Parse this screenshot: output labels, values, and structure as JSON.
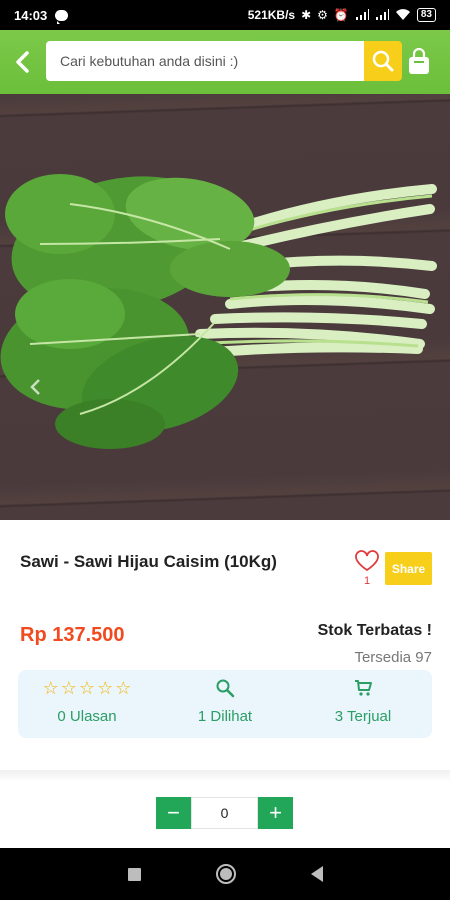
{
  "status_bar": {
    "time": "14:03",
    "network_speed": "521KB/s",
    "battery": "83"
  },
  "header": {
    "search_placeholder": "Cari kebutuhan anda disini :)"
  },
  "product": {
    "title": "Sawi - Sawi Hijau Caisim (10Kg)",
    "favorite_count": "1",
    "share_label": "Share",
    "price": "Rp 137.500",
    "stock_status": "Stok Terbatas !",
    "available": "Tersedia 97"
  },
  "stats": {
    "reviews_label": "0 Ulasan",
    "rating_stars": 0,
    "views_label": "1 Dilihat",
    "sold_label": "3 Terjual"
  },
  "quantity": {
    "value": "0",
    "minus": "−",
    "plus": "+"
  },
  "colors": {
    "header_green": "#6bbf3a",
    "accent_yellow": "#f7cf1a",
    "price_orange": "#f04a1e",
    "button_green": "#21a757",
    "stat_text": "#2a9e64"
  }
}
